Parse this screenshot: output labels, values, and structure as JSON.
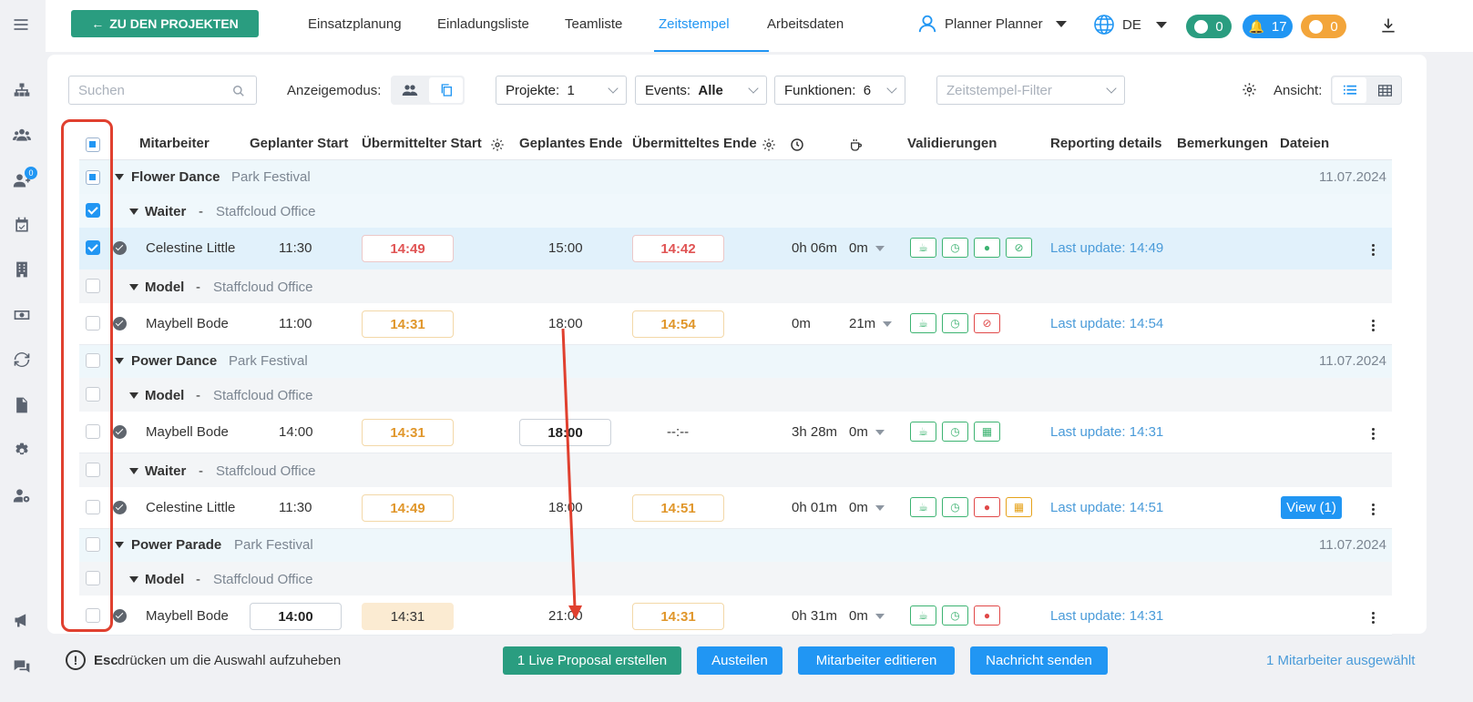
{
  "sidebar": {
    "badge": "0",
    "icons": [
      "hierarchy-icon",
      "team-icon",
      "add-user-icon",
      "calendar-check-icon",
      "building-icon",
      "money-icon",
      "sync-icon",
      "document-icon",
      "gear-icon",
      "user-settings-icon",
      "megaphone-icon",
      "chat-icon"
    ]
  },
  "topbar": {
    "back_label": "ZU DEN PROJEKTEN",
    "tabs": [
      "Einsatzplanung",
      "Einladungsliste",
      "Teamliste",
      "Zeitstempel",
      "Arbeitsdaten"
    ],
    "active_tab": "Zeitstempel",
    "user": "Planner Planner",
    "language": "DE",
    "messages": "0",
    "notifications": "17",
    "clock_count": "0"
  },
  "filters": {
    "search_placeholder": "Suchen",
    "display_mode_label": "Anzeigemodus:",
    "projects_label": "Projekte:",
    "projects_value": "1",
    "events_label": "Events:",
    "events_value": "Alle",
    "functions_label": "Funktionen:",
    "functions_value": "6",
    "timestamp_filter_placeholder": "Zeitstempel-Filter",
    "view_label": "Ansicht:"
  },
  "table": {
    "headers": {
      "employee": "Mitarbeiter",
      "planned_start": "Geplanter Start",
      "submitted_start": "Übermittelter Start",
      "planned_end": "Geplantes Ende",
      "submitted_end": "Übermitteltes Ende",
      "validations": "Validierungen",
      "reporting": "Reporting details",
      "remarks": "Bemerkungen",
      "files": "Dateien"
    },
    "projects": [
      {
        "name": "Flower Dance",
        "event": "Park Festival",
        "date": "11.07.2024"
      },
      {
        "name": "Power Dance",
        "event": "Park Festival",
        "date": "11.07.2024"
      },
      {
        "name": "Power Parade",
        "event": "Park Festival",
        "date": "11.07.2024"
      }
    ],
    "roles": [
      {
        "name": "Waiter",
        "sep": "-",
        "location": "Staffcloud Office"
      },
      {
        "name": "Model",
        "sep": "-",
        "location": "Staffcloud Office"
      },
      {
        "name": "Model",
        "sep": "-",
        "location": "Staffcloud Office"
      },
      {
        "name": "Waiter",
        "sep": "-",
        "location": "Staffcloud Office"
      },
      {
        "name": "Model",
        "sep": "-",
        "location": "Staffcloud Office"
      }
    ],
    "rows": [
      {
        "name": "Celestine Little",
        "planned_start": "11:30",
        "submitted_start": "14:49",
        "planned_end": "15:00",
        "submitted_end": "14:42",
        "duration": "0h 06m",
        "break": "0m",
        "reporting": "Last update: 14:49"
      },
      {
        "name": "Maybell Bode",
        "planned_start": "11:00",
        "submitted_start": "14:31",
        "planned_end": "18:00",
        "submitted_end": "14:54",
        "duration": "0m",
        "break": "21m",
        "reporting": "Last update: 14:54"
      },
      {
        "name": "Maybell Bode",
        "planned_start": "14:00",
        "submitted_start": "14:31",
        "planned_end": "18:00",
        "submitted_end": "--:--",
        "duration": "3h 28m",
        "break": "0m",
        "reporting": "Last update: 14:31"
      },
      {
        "name": "Celestine Little",
        "planned_start": "11:30",
        "submitted_start": "14:49",
        "planned_end": "18:00",
        "submitted_end": "14:51",
        "duration": "0h 01m",
        "break": "0m",
        "reporting": "Last update: 14:51",
        "files": "View (1)"
      },
      {
        "name": "Maybell Bode",
        "planned_start": "14:00",
        "submitted_start": "14:31",
        "planned_end": "21:00",
        "submitted_end": "14:31",
        "duration": "0h 31m",
        "break": "0m",
        "reporting": "Last update: 14:31"
      }
    ]
  },
  "bottom": {
    "hint_key": "Esc",
    "hint_text": "drücken um die Auswahl aufzuheben",
    "btn_proposal": "1 Live Proposal erstellen",
    "btn_share": "Austeilen",
    "btn_edit": "Mitarbeiter editieren",
    "btn_message": "Nachricht senden",
    "selected": "1 Mitarbeiter ausgewählt"
  },
  "colors": {
    "accent": "#2196f3",
    "green": "#2a9d80",
    "annotation": "#e0402f"
  }
}
